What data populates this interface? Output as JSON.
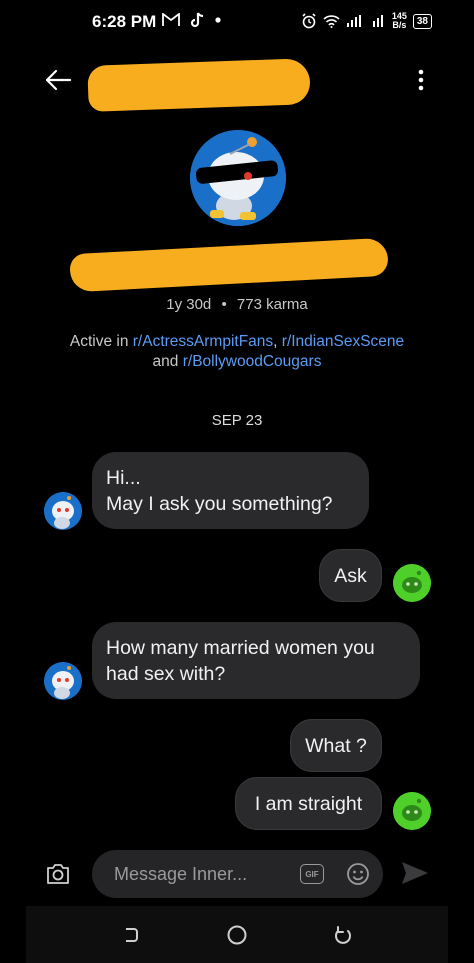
{
  "status_bar": {
    "time": "6:28 PM",
    "net_speed_value": "145",
    "net_speed_unit": "B/s",
    "battery": "38"
  },
  "profile": {
    "age": "1y 30d",
    "separator": "•",
    "karma": "773 karma",
    "active_prefix": "Active in",
    "communities": [
      "r/ActressArmpitFans",
      "r/IndianSexScene",
      "r/BollywoodCougars"
    ],
    "joiner_comma": ",",
    "joiner_and": "and"
  },
  "chat": {
    "date": "SEP 23",
    "messages": [
      {
        "sender": "them",
        "line1": "Hi...",
        "line2": "May I ask you something?"
      },
      {
        "sender": "me",
        "text": "Ask"
      },
      {
        "sender": "them",
        "line1": "How many married women you",
        "line2": "had sex with?"
      },
      {
        "sender": "me",
        "text": "What ?"
      },
      {
        "sender": "me",
        "text": "I am straight"
      }
    ]
  },
  "composer": {
    "placeholder": "Message Inner...",
    "gif_label": "GIF"
  },
  "colors": {
    "background": "#000000",
    "bubble": "#2a2a2c",
    "link": "#5b9cf5",
    "redaction": "#f7ad1e",
    "their_avatar": "#1a6fc9",
    "my_avatar": "#4fcf2a"
  }
}
